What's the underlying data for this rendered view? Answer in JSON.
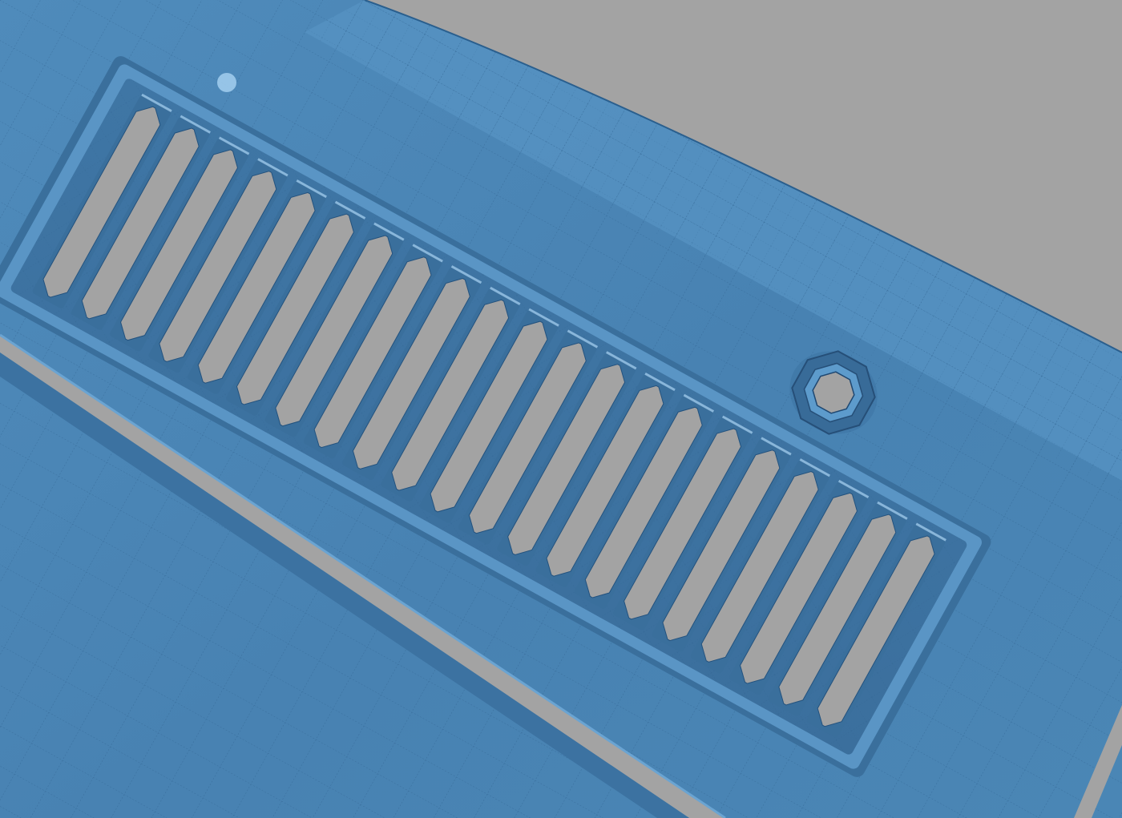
{
  "scene": {
    "subject": "cad-vent-grille-surface",
    "slot_count": 21,
    "fastener_hole_count": 1,
    "colors": {
      "background": "#a3a3a3",
      "surface": "#4b86b6",
      "surface_dark": "#3a6f9c",
      "surface_light": "#6ea6d4",
      "highlight": "#a9d3f2",
      "mesh_line": "#23527e",
      "cutout": "#a3a3a3"
    }
  }
}
